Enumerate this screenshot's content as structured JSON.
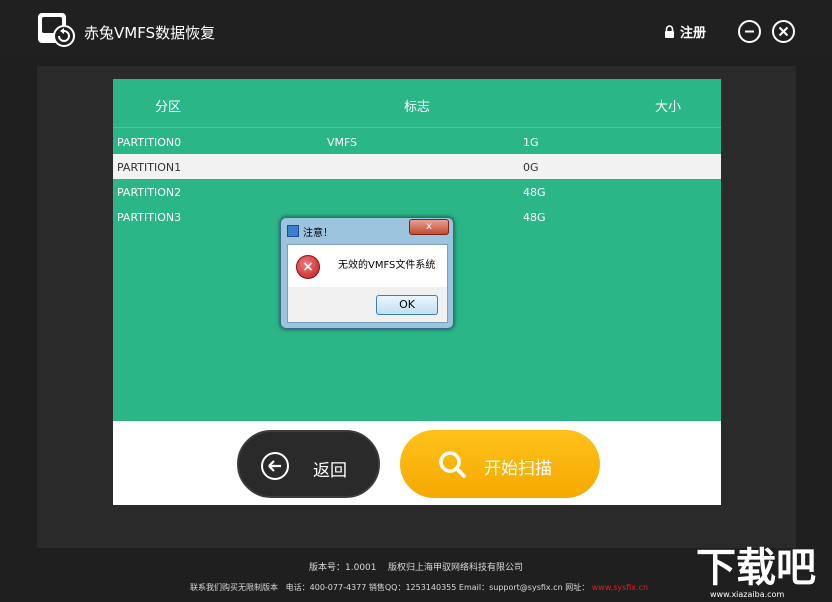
{
  "app": {
    "title": "赤兔VMFS数据恢复"
  },
  "header": {
    "register_label": "注册"
  },
  "table": {
    "columns": [
      "分区",
      "标志",
      "大小"
    ],
    "rows": [
      {
        "partition": "PARTITION0",
        "flag": "VMFS",
        "size": "1G"
      },
      {
        "partition": "PARTITION1",
        "flag": "",
        "size": "0G"
      },
      {
        "partition": "PARTITION2",
        "flag": "",
        "size": "48G"
      },
      {
        "partition": "PARTITION3",
        "flag": "",
        "size": "48G"
      }
    ]
  },
  "buttons": {
    "back_label": "返回",
    "scan_label": "开始扫描"
  },
  "dialog": {
    "title": "注意！",
    "message": "无效的VMFS文件系统",
    "ok_label": "OK",
    "close_label": "x"
  },
  "footer": {
    "version": "版本号：1.0001",
    "copyright": "版权归上海甲驭网络科技有限公司",
    "contact": "联系我们购买无限制版本",
    "phone": "电话：400-077-4377 销售QQ：1253140355 Email：support@sysfix.cn 网址：",
    "site": "www.sysfix.cn"
  },
  "watermark": {
    "text": "下载吧",
    "url": "www.xiazaiba.com"
  },
  "colors": {
    "table_green": "#2bb688",
    "accent_orange": "#f5a800",
    "dark_bg": "#1f1f20"
  }
}
